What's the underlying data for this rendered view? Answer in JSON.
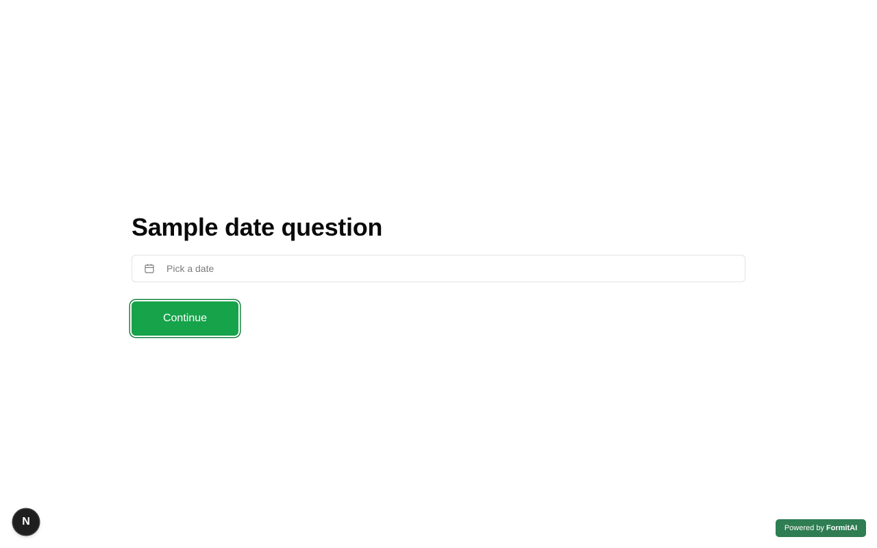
{
  "question": {
    "title": "Sample date question",
    "date_placeholder": "Pick a date",
    "calendar_icon": "calendar-icon"
  },
  "actions": {
    "continue_label": "Continue",
    "accent_color": "#16a34a"
  },
  "nav_badge": {
    "letter": "N"
  },
  "footer": {
    "powered_prefix": "Powered by",
    "powered_brand": "FormitAI",
    "badge_color": "#2f7d52"
  }
}
